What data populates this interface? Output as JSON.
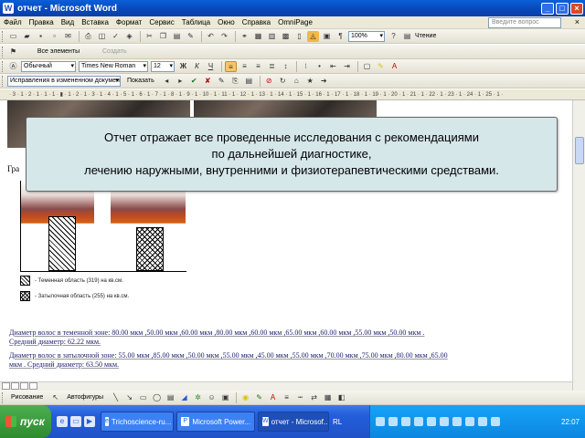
{
  "window": {
    "title": "отчет - Microsoft Word",
    "app_icon": "W",
    "controls": [
      "_",
      "□",
      "×"
    ]
  },
  "menu": {
    "items": [
      "Файл",
      "Правка",
      "Вид",
      "Вставка",
      "Формат",
      "Сервис",
      "Таблица",
      "Окно",
      "Справка",
      "OmniPage"
    ],
    "help_placeholder": "Введите вопрос",
    "close_doc": "×"
  },
  "toolbar_standard": {
    "zoom": "100%",
    "reading_label": "Чтение",
    "paragraph_mark": "¶"
  },
  "toolbar_styles": {
    "elements_button": "Все элементы",
    "create_button": "Создать"
  },
  "toolbar_format": {
    "style": "Обычный",
    "font": "Times New Roman",
    "size": "12",
    "bold": "Ж",
    "italic": "К",
    "underline": "Ч"
  },
  "toolbar_review": {
    "mode": "Исправления в измененном документе",
    "show_button": "Показать"
  },
  "ruler": {
    "text": "· 3 · 1 · 2 · 1 · 1 · 1 · ▮ · 1 · 2 · 1 · 3 · 1 · 4 · 1 · 5 · 1 · 6 · 1 · 7 · 1 · 8 · 1 · 9 · 1 · 10 · 1 · 11 · 1 · 12 · 1 · 13 · 1 · 14 · 1 · 15 · 1 · 16 · 1 · 17 · 1 · 18 · 1 · 19 · 1 · 20 · 1 · 21 · 1 · 22 · 1 · 23 · 1 · 24 · 1 · 25 · 1 ·"
  },
  "document": {
    "heading_fragment": "Гра",
    "legend": [
      "- Теменная область (319) на кв.см.",
      "- Затылочная область (255) на кв.см."
    ],
    "chart_values": [
      319,
      255
    ],
    "para1_line1": "Диаметр волос в теменной зоне: 80.00 мкм ,50.00 мкм ,60.00 мкм ,80.00 мкм ,60.00 мкм ,65.00 мкм ,60.00 мкм ,55.00 мкм ,50.00 мкм .",
    "para1_line2": "Средний диаметр: 62.22 мкм.",
    "para2_line1": "Диаметр волос в затылочной зоне: 55.00 мкм ,85.00 мкм ,50.00 мкм ,55.00 мкм ,45.00 мкм ,55.00 мкм ,70.00 мкм ,75.00 мкм ,80.00 мкм ,65.00",
    "para2_line2": "мкм . Средний диаметр: 63.50 мкм."
  },
  "callout": {
    "line1": "Отчет отражает все проведенные исследования с рекомендациями",
    "line2": "по дальнейшей диагностике,",
    "line3": "лечению наружными, внутренними и физиотерапевтическими средствами."
  },
  "drawbar": {
    "draw_menu": "Рисование",
    "autoshapes": "Автофигуры"
  },
  "taskbar": {
    "start": "пуск",
    "tasks": [
      "Trichoscience-ru...",
      "Microsoft Power...",
      "отчет - Microsof..."
    ],
    "language": "RL",
    "clock": "22:07"
  }
}
